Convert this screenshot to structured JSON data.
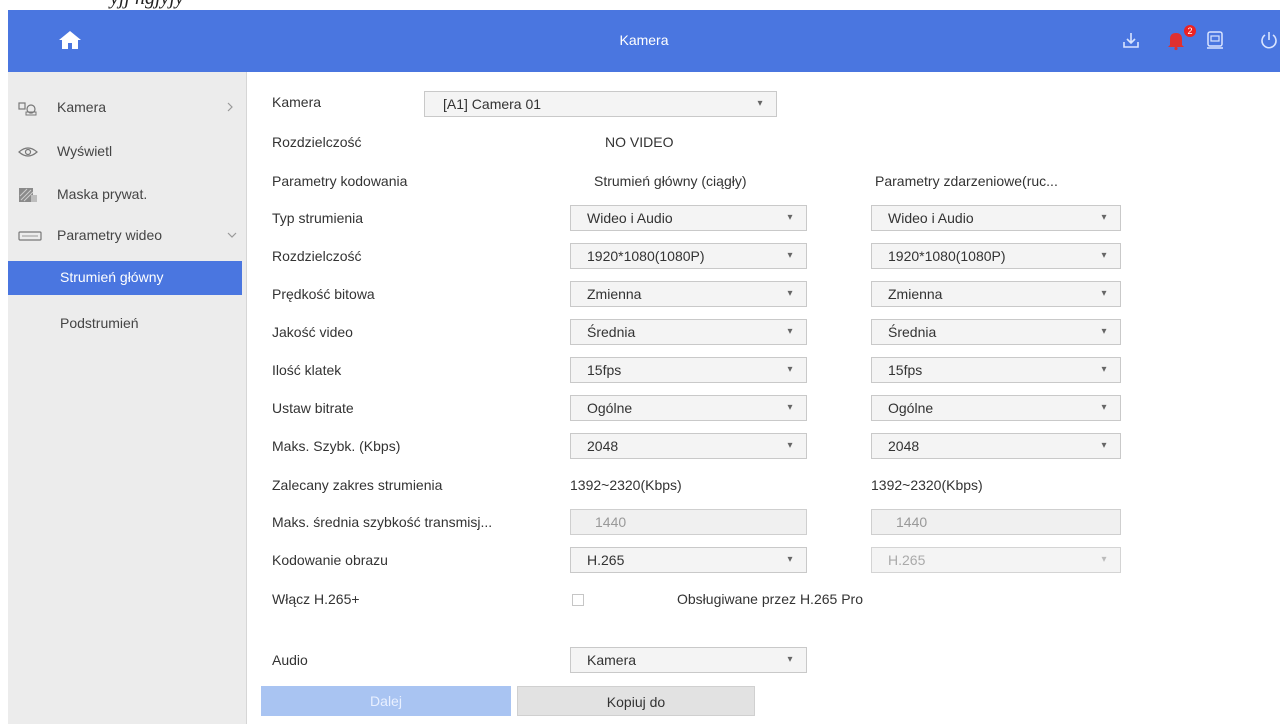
{
  "top_strip_text": "yjj ngjyjy",
  "header": {
    "title": "Kamera",
    "icons": [
      "home-icon",
      "download-icon",
      "alarm-bell-icon",
      "record-icon",
      "power-icon"
    ],
    "alarm_count": "2",
    "bg_color": "#4a76e0"
  },
  "sidebar": {
    "items": [
      {
        "label": "Kamera",
        "icon": "camera-icon",
        "chevron": "right"
      },
      {
        "label": "Wyświetl",
        "icon": "eye-icon"
      },
      {
        "label": "Maska prywat.",
        "icon": "privacy-mask-icon"
      },
      {
        "label": "Parametry wideo",
        "icon": "video-params-icon",
        "chevron": "down"
      }
    ],
    "subitems": [
      {
        "label": "Strumień główny",
        "active": true
      },
      {
        "label": "Podstrumień",
        "active": false
      }
    ],
    "active_color": "#4a76e0"
  },
  "form": {
    "camera_label": "Kamera",
    "camera_value": "[A1] Camera 01",
    "resolution_label": "Rozdzielczość",
    "resolution_value": "NO VIDEO",
    "encoding_label": "Parametry kodowania",
    "col_main_header": "Strumień główny (ciągły)",
    "col_event_header": "Parametry zdarzeniowe(ruc...",
    "rows": [
      {
        "label": "Typ strumienia",
        "main": "Wideo i Audio",
        "event": "Wideo i Audio"
      },
      {
        "label": "Rozdzielczość",
        "main": "1920*1080(1080P)",
        "event": "1920*1080(1080P)"
      },
      {
        "label": "Prędkość bitowa",
        "main": "Zmienna",
        "event": "Zmienna"
      },
      {
        "label": "Jakość video",
        "main": "Średnia",
        "event": "Średnia"
      },
      {
        "label": "Ilość klatek",
        "main": "15fps",
        "event": "15fps"
      },
      {
        "label": "Ustaw bitrate",
        "main": "Ogólne",
        "event": "Ogólne"
      },
      {
        "label": "Maks. Szybk. (Kbps)",
        "main": "2048",
        "event": "2048"
      }
    ],
    "recommended_label": "Zalecany zakres strumienia",
    "recommended_main": "1392~2320(Kbps)",
    "recommended_event": "1392~2320(Kbps)",
    "avg_label": "Maks. średnia szybkość transmisj...",
    "avg_main": "1440",
    "avg_event": "1440",
    "codec_label": "Kodowanie obrazu",
    "codec_main": "H.265",
    "codec_event": "H.265",
    "h265plus_label": "Włącz H.265+",
    "h265plus_checked": false,
    "h265pro_note": "Obsługiwane przez H.265 Pro",
    "audio_label": "Audio",
    "audio_value": "Kamera"
  },
  "buttons": {
    "next": "Dalej",
    "copy": "Kopiuj do"
  }
}
